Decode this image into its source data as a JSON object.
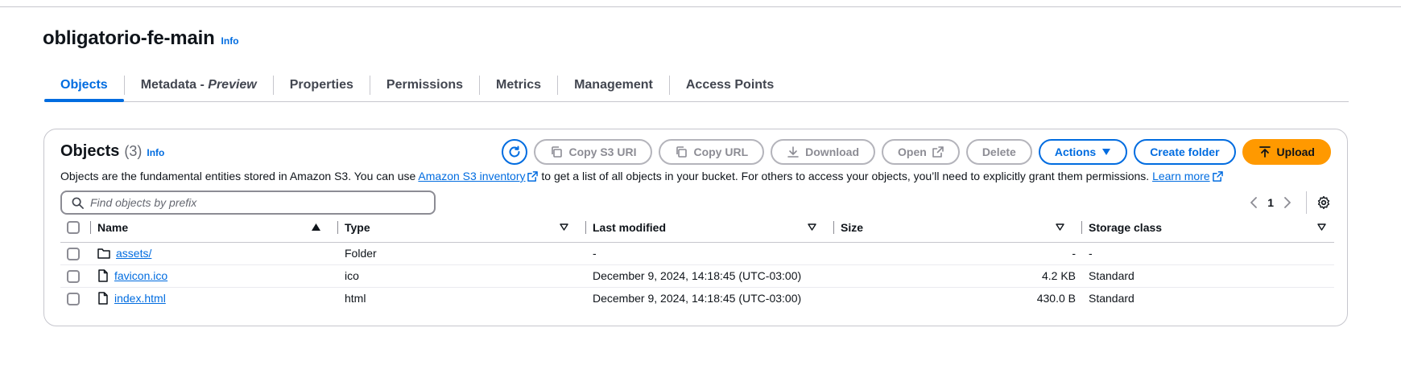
{
  "bucket": {
    "name": "obligatorio-fe-main",
    "info_label": "Info"
  },
  "tabs": [
    {
      "label": "Objects"
    },
    {
      "label": "Metadata - ",
      "label_suffix": "Preview"
    },
    {
      "label": "Properties"
    },
    {
      "label": "Permissions"
    },
    {
      "label": "Metrics"
    },
    {
      "label": "Management"
    },
    {
      "label": "Access Points"
    }
  ],
  "panel": {
    "title": "Objects",
    "count": "(3)",
    "info_label": "Info",
    "desc_part1": "Objects are the fundamental entities stored in Amazon S3. You can use ",
    "desc_link1": "Amazon S3 inventory",
    "desc_part2": " to get a list of all objects in your bucket. For others to access your objects, you’ll need to explicitly grant them permissions. ",
    "desc_link2": "Learn more"
  },
  "toolbar": {
    "copy_s3_uri": "Copy S3 URI",
    "copy_url": "Copy URL",
    "download": "Download",
    "open": "Open",
    "delete": "Delete",
    "actions": "Actions",
    "create_folder": "Create folder",
    "upload": "Upload"
  },
  "search": {
    "placeholder": "Find objects by prefix",
    "value": ""
  },
  "pagination": {
    "current_page": "1"
  },
  "table": {
    "columns": [
      "Name",
      "Type",
      "Last modified",
      "Size",
      "Storage class"
    ],
    "rows": [
      {
        "name": "assets/",
        "icon": "folder-icon",
        "type": "Folder",
        "last_modified": "-",
        "size": "-",
        "storage_class": "-"
      },
      {
        "name": "favicon.ico",
        "icon": "file-icon",
        "type": "ico",
        "last_modified": "December 9, 2024, 14:18:45 (UTC-03:00)",
        "size": "4.2 KB",
        "storage_class": "Standard"
      },
      {
        "name": "index.html",
        "icon": "file-icon",
        "type": "html",
        "last_modified": "December 9, 2024, 14:18:45 (UTC-03:00)",
        "size": "430.0 B",
        "storage_class": "Standard"
      }
    ]
  },
  "colors": {
    "link": "#006ce0",
    "upload": "#ff9900",
    "border": "#c6c6cd",
    "disabled": "#8c8c94"
  }
}
